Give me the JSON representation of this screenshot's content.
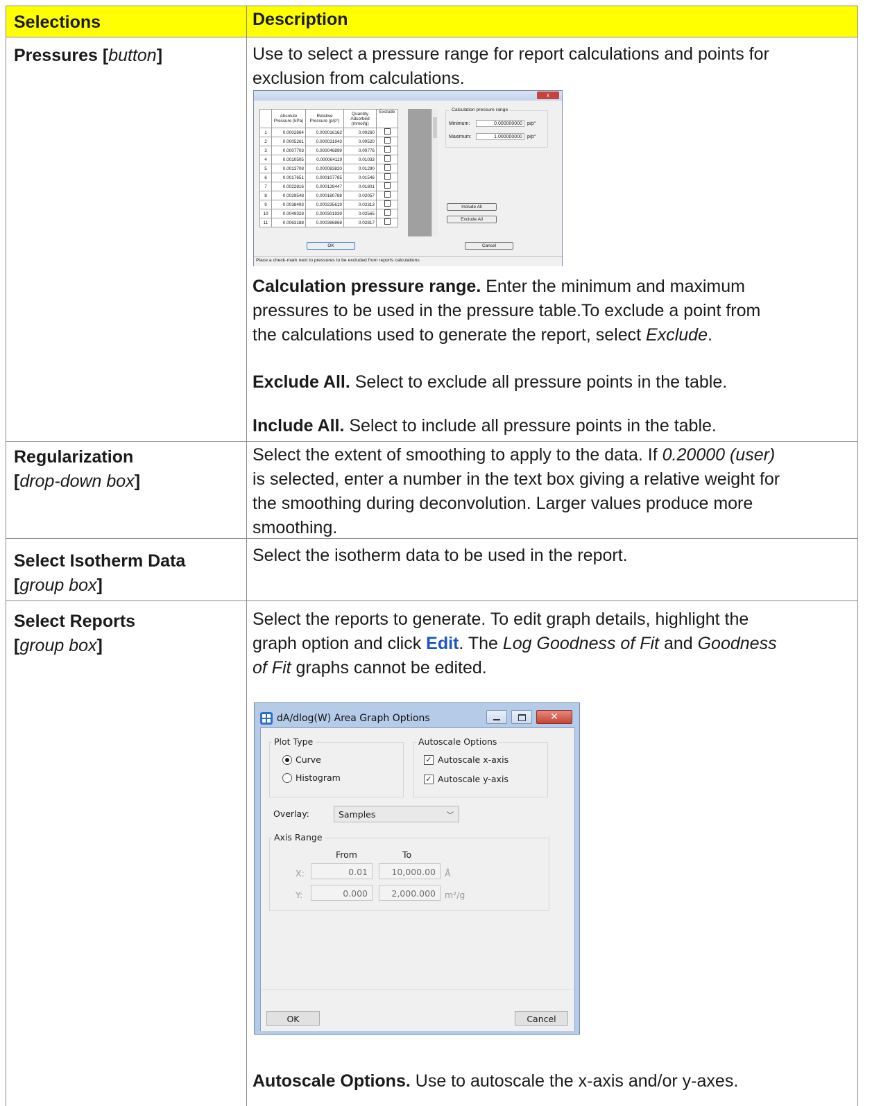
{
  "header": {
    "selections": "Selections",
    "description": "Description"
  },
  "rows": {
    "pressures": {
      "title_bold": "Pressures [",
      "title_italic": "button",
      "title_end": "]",
      "desc_line1": "Use to select a pressure range for report calculations and points for",
      "desc_line2": "exclusion from calculations.",
      "calc_title": "Calculation pressure range.",
      "calc_line1": " Enter the minimum and maximum",
      "calc_line2": "pressures to be used in the pressure table.To exclude a point from",
      "calc_line3a": "the calculations used to generate the report, select ",
      "calc_line3_italic": "Exclude",
      "calc_line3_end": ".",
      "exclude_title": "Exclude All.",
      "exclude_text": " Select to exclude all pressure points in the table.",
      "include_title": "Include All.",
      "include_text": " Select to include all pressure points in the table."
    },
    "regularization": {
      "title": "Regularization",
      "sub_open": "[",
      "sub_italic": "drop-down box",
      "sub_close": "]",
      "line1a": "Select the extent of smoothing to apply to the data. If ",
      "line1_italic": "0.20000 (user)",
      "line2": "is selected, enter a number in the text box giving a relative weight for",
      "line3": "the smoothing during deconvolution. Larger values produce more",
      "line4": "smoothing."
    },
    "isotherm": {
      "title": "Select Isotherm Data",
      "sub_open": "[",
      "sub_italic": "group box",
      "sub_close": "]",
      "desc": "Select the isotherm data to be used in the report."
    },
    "reports": {
      "title": "Select Reports",
      "sub_open": "[",
      "sub_italic": "group box",
      "sub_close": "]",
      "line1": "Select the reports to generate. To edit graph details, highlight the",
      "line2a": "graph option and click ",
      "line2_link": "Edit",
      "line2b": ". The ",
      "line2_i1": "Log Goodness of Fit",
      "line2c": " and ",
      "line2_i2": "Goodness",
      "line3_i": "of Fit",
      "line3b": " graphs cannot be edited.",
      "autoscale_title": "Autoscale Options.",
      "autoscale_text": " Use to autoscale the x-axis and/or y-axes."
    }
  },
  "pressure_dialog": {
    "close": "x",
    "columns": [
      "",
      "Absolute Pressure (kPa)",
      "Relative Pressure (p/p°)",
      "Quantity Adsorbed (mmol/g)",
      "Exclude"
    ],
    "table_rows": [
      [
        "1",
        "0.0002864",
        "0.000016162",
        "0.00260"
      ],
      [
        "2",
        "0.0005261",
        "0.000031943",
        "0.00520"
      ],
      [
        "3",
        "0.0007703",
        "0.000046899",
        "0.00776"
      ],
      [
        "4",
        "0.0010505",
        "0.000064119",
        "0.01033"
      ],
      [
        "5",
        "0.0013708",
        "0.000083820",
        "0.01290"
      ],
      [
        "6",
        "0.0017651",
        "0.000107785",
        "0.01546"
      ],
      [
        "7",
        "0.0022816",
        "0.000139447",
        "0.01801"
      ],
      [
        "8",
        "0.0029548",
        "0.000180788",
        "0.02057"
      ],
      [
        "9",
        "0.0038493",
        "0.000235619",
        "0.02313"
      ],
      [
        "10",
        "0.0049328",
        "0.000301939",
        "0.02565"
      ],
      [
        "11",
        "0.0063188",
        "0.000386868",
        "0.02817"
      ]
    ],
    "range_title": "Calculation pressure range",
    "min_label": "Minimum:",
    "min_value": "0.000000000",
    "max_label": "Maximum:",
    "max_value": "1.000000000",
    "unit": "p/p°",
    "include_all": "Include All",
    "exclude_all": "Exclude All",
    "ok": "OK",
    "cancel": "Cancel",
    "status": "Place a check-mark next to pressures to be excluded from reports calculations"
  },
  "graph_dialog": {
    "title": "dA/dlog(W) Area Graph Options",
    "plot_type": "Plot Type",
    "curve": "Curve",
    "histogram": "Histogram",
    "plot_selected": "Curve",
    "autoscale": "Autoscale Options",
    "autoscale_x": "Autoscale x-axis",
    "autoscale_y": "Autoscale y-axis",
    "autoscale_x_checked": true,
    "autoscale_y_checked": true,
    "overlay_label": "Overlay:",
    "overlay_value": "Samples",
    "axis_range": "Axis Range",
    "from": "From",
    "to": "To",
    "x_label": "X:",
    "x_from": "0.01",
    "x_to": "10,000.00",
    "x_unit": "Å",
    "y_label": "Y:",
    "y_from": "0.000",
    "y_to": "2,000.000",
    "y_unit": "m²/g",
    "ok": "OK",
    "cancel": "Cancel"
  },
  "colors": {
    "header_bg": "#ffff00",
    "link": "#1a55c8",
    "grid": "#888888"
  }
}
